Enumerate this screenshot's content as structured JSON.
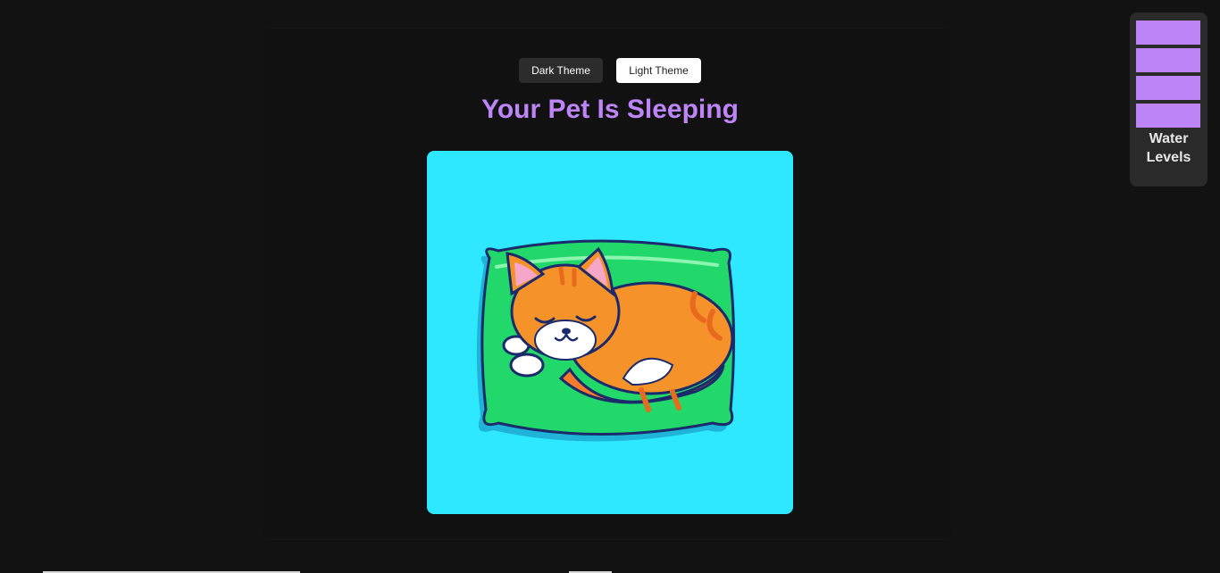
{
  "theme_buttons": {
    "dark_label": "Dark Theme",
    "light_label": "Light Theme"
  },
  "title": "Your Pet Is Sleeping",
  "pet_image": {
    "alt": "sleeping cat on pillow"
  },
  "water_widget": {
    "label_line1": "Water",
    "label_line2": "Levels",
    "levels_filled": 4,
    "levels_total": 4
  },
  "colors": {
    "background": "#121212",
    "accent": "#bd85f8",
    "image_background": "#2de8ff"
  }
}
